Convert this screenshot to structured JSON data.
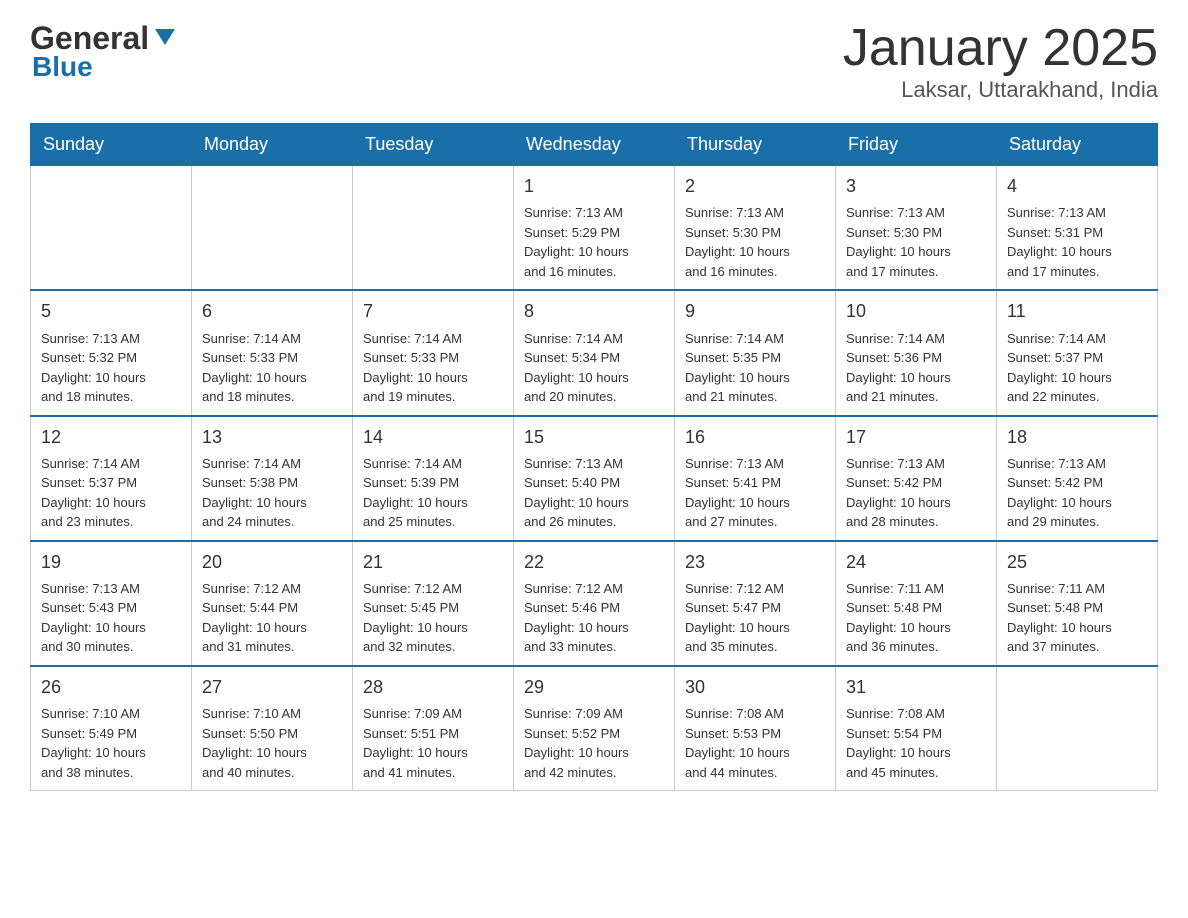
{
  "header": {
    "logo_general": "General",
    "logo_blue": "Blue",
    "month_year": "January 2025",
    "location": "Laksar, Uttarakhand, India"
  },
  "days_of_week": [
    "Sunday",
    "Monday",
    "Tuesday",
    "Wednesday",
    "Thursday",
    "Friday",
    "Saturday"
  ],
  "weeks": [
    {
      "days": [
        {
          "number": "",
          "info": ""
        },
        {
          "number": "",
          "info": ""
        },
        {
          "number": "",
          "info": ""
        },
        {
          "number": "1",
          "info": "Sunrise: 7:13 AM\nSunset: 5:29 PM\nDaylight: 10 hours\nand 16 minutes."
        },
        {
          "number": "2",
          "info": "Sunrise: 7:13 AM\nSunset: 5:30 PM\nDaylight: 10 hours\nand 16 minutes."
        },
        {
          "number": "3",
          "info": "Sunrise: 7:13 AM\nSunset: 5:30 PM\nDaylight: 10 hours\nand 17 minutes."
        },
        {
          "number": "4",
          "info": "Sunrise: 7:13 AM\nSunset: 5:31 PM\nDaylight: 10 hours\nand 17 minutes."
        }
      ]
    },
    {
      "days": [
        {
          "number": "5",
          "info": "Sunrise: 7:13 AM\nSunset: 5:32 PM\nDaylight: 10 hours\nand 18 minutes."
        },
        {
          "number": "6",
          "info": "Sunrise: 7:14 AM\nSunset: 5:33 PM\nDaylight: 10 hours\nand 18 minutes."
        },
        {
          "number": "7",
          "info": "Sunrise: 7:14 AM\nSunset: 5:33 PM\nDaylight: 10 hours\nand 19 minutes."
        },
        {
          "number": "8",
          "info": "Sunrise: 7:14 AM\nSunset: 5:34 PM\nDaylight: 10 hours\nand 20 minutes."
        },
        {
          "number": "9",
          "info": "Sunrise: 7:14 AM\nSunset: 5:35 PM\nDaylight: 10 hours\nand 21 minutes."
        },
        {
          "number": "10",
          "info": "Sunrise: 7:14 AM\nSunset: 5:36 PM\nDaylight: 10 hours\nand 21 minutes."
        },
        {
          "number": "11",
          "info": "Sunrise: 7:14 AM\nSunset: 5:37 PM\nDaylight: 10 hours\nand 22 minutes."
        }
      ]
    },
    {
      "days": [
        {
          "number": "12",
          "info": "Sunrise: 7:14 AM\nSunset: 5:37 PM\nDaylight: 10 hours\nand 23 minutes."
        },
        {
          "number": "13",
          "info": "Sunrise: 7:14 AM\nSunset: 5:38 PM\nDaylight: 10 hours\nand 24 minutes."
        },
        {
          "number": "14",
          "info": "Sunrise: 7:14 AM\nSunset: 5:39 PM\nDaylight: 10 hours\nand 25 minutes."
        },
        {
          "number": "15",
          "info": "Sunrise: 7:13 AM\nSunset: 5:40 PM\nDaylight: 10 hours\nand 26 minutes."
        },
        {
          "number": "16",
          "info": "Sunrise: 7:13 AM\nSunset: 5:41 PM\nDaylight: 10 hours\nand 27 minutes."
        },
        {
          "number": "17",
          "info": "Sunrise: 7:13 AM\nSunset: 5:42 PM\nDaylight: 10 hours\nand 28 minutes."
        },
        {
          "number": "18",
          "info": "Sunrise: 7:13 AM\nSunset: 5:42 PM\nDaylight: 10 hours\nand 29 minutes."
        }
      ]
    },
    {
      "days": [
        {
          "number": "19",
          "info": "Sunrise: 7:13 AM\nSunset: 5:43 PM\nDaylight: 10 hours\nand 30 minutes."
        },
        {
          "number": "20",
          "info": "Sunrise: 7:12 AM\nSunset: 5:44 PM\nDaylight: 10 hours\nand 31 minutes."
        },
        {
          "number": "21",
          "info": "Sunrise: 7:12 AM\nSunset: 5:45 PM\nDaylight: 10 hours\nand 32 minutes."
        },
        {
          "number": "22",
          "info": "Sunrise: 7:12 AM\nSunset: 5:46 PM\nDaylight: 10 hours\nand 33 minutes."
        },
        {
          "number": "23",
          "info": "Sunrise: 7:12 AM\nSunset: 5:47 PM\nDaylight: 10 hours\nand 35 minutes."
        },
        {
          "number": "24",
          "info": "Sunrise: 7:11 AM\nSunset: 5:48 PM\nDaylight: 10 hours\nand 36 minutes."
        },
        {
          "number": "25",
          "info": "Sunrise: 7:11 AM\nSunset: 5:48 PM\nDaylight: 10 hours\nand 37 minutes."
        }
      ]
    },
    {
      "days": [
        {
          "number": "26",
          "info": "Sunrise: 7:10 AM\nSunset: 5:49 PM\nDaylight: 10 hours\nand 38 minutes."
        },
        {
          "number": "27",
          "info": "Sunrise: 7:10 AM\nSunset: 5:50 PM\nDaylight: 10 hours\nand 40 minutes."
        },
        {
          "number": "28",
          "info": "Sunrise: 7:09 AM\nSunset: 5:51 PM\nDaylight: 10 hours\nand 41 minutes."
        },
        {
          "number": "29",
          "info": "Sunrise: 7:09 AM\nSunset: 5:52 PM\nDaylight: 10 hours\nand 42 minutes."
        },
        {
          "number": "30",
          "info": "Sunrise: 7:08 AM\nSunset: 5:53 PM\nDaylight: 10 hours\nand 44 minutes."
        },
        {
          "number": "31",
          "info": "Sunrise: 7:08 AM\nSunset: 5:54 PM\nDaylight: 10 hours\nand 45 minutes."
        },
        {
          "number": "",
          "info": ""
        }
      ]
    }
  ]
}
